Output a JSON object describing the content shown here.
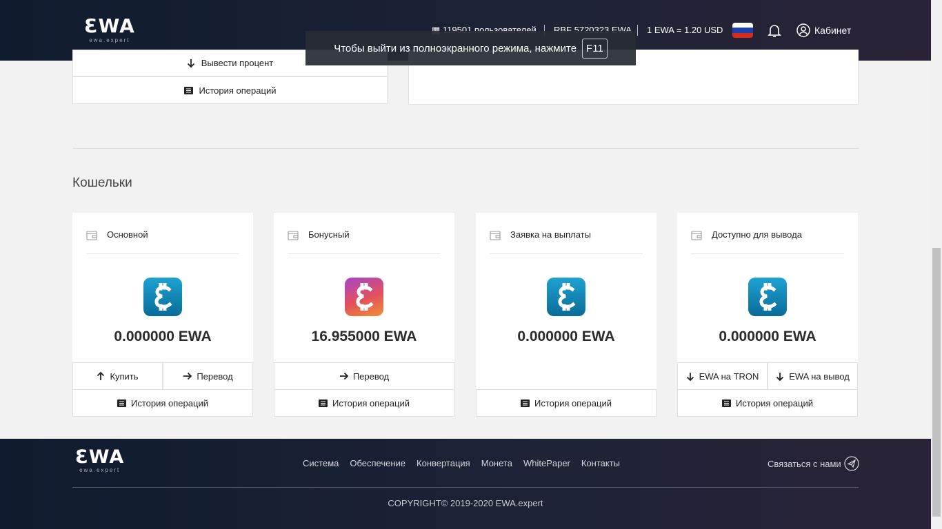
{
  "header": {
    "logo_text": "ƐWA",
    "logo_sub": "ewa.expert",
    "users": "119501 пользователей",
    "reserve": "RBF 5720323 EWA",
    "rate": "1 EWA = 1.20 USD",
    "cabinet": "Кабинет"
  },
  "toast": {
    "text": "Чтобы выйти из полноэкранного режима, нажмите",
    "key": "F11"
  },
  "top_panel": {
    "withdraw_percent": "Вывести процент",
    "history": "История операций"
  },
  "wallets_section": {
    "title": "Кошельки",
    "wallets": [
      {
        "name": "Основной",
        "amount": "0.000000 EWA",
        "btn1": "Купить",
        "btn2": "Перевод",
        "history": "История операций"
      },
      {
        "name": "Бонусный",
        "amount": "16.955000 EWA",
        "btn1": "Перевод",
        "history": "История операций"
      },
      {
        "name": "Заявка на выплаты",
        "amount": "0.000000 EWA",
        "history": "История операций"
      },
      {
        "name": "Доступно для вывода",
        "amount": "0.000000 EWA",
        "btn1": "EWA на TRON",
        "btn2": "EWA на вывод",
        "history": "История операций"
      }
    ]
  },
  "footer": {
    "logo_text": "ƐWA",
    "logo_sub": "ewa.expert",
    "nav": [
      "Система",
      "Обеспечение",
      "Конвертация",
      "Монета",
      "WhitePaper",
      "Контакты"
    ],
    "contact": "Связаться с нами",
    "copyright": "COPYRIGHT© 2019-2020 EWA.expert"
  },
  "colors": {
    "header_bg": "#0f1b2e",
    "coin_blue": "#1ea2d2",
    "coin_bonus": "#e3515c"
  }
}
